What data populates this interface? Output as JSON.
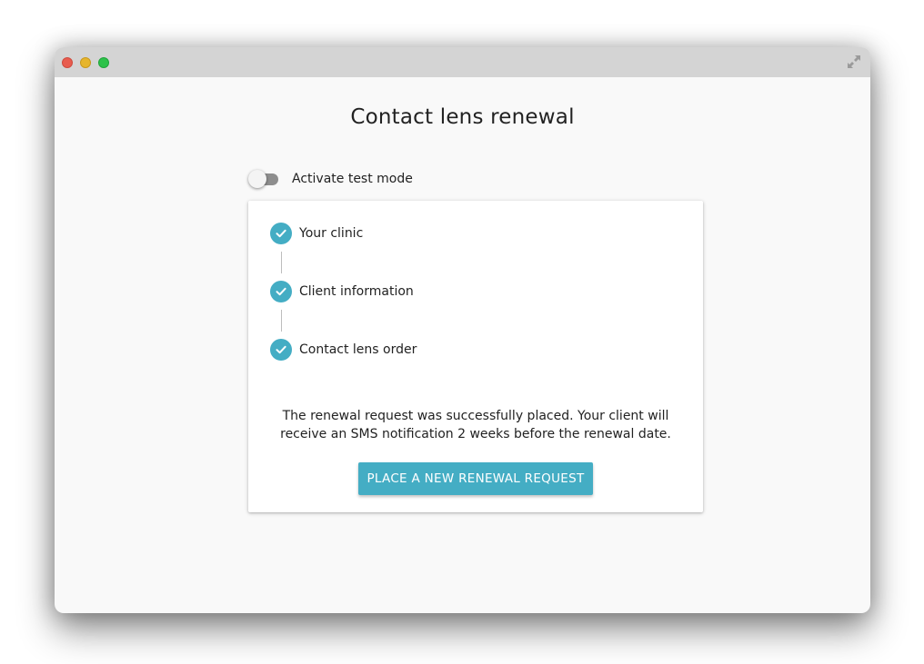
{
  "page": {
    "title": "Contact lens renewal"
  },
  "test_mode": {
    "label": "Activate test mode",
    "enabled": false
  },
  "steps": [
    {
      "label": "Your clinic",
      "completed": true,
      "icon": "check-icon"
    },
    {
      "label": "Client information",
      "completed": true,
      "icon": "check-icon"
    },
    {
      "label": "Contact lens order",
      "completed": true,
      "icon": "check-icon"
    }
  ],
  "confirmation": {
    "message": "The renewal request was successfully placed. Your client will receive an SMS notification 2 weeks before the renewal date."
  },
  "actions": {
    "new_request_label": "PLACE A NEW RENEWAL REQUEST"
  },
  "colors": {
    "accent": "#44adc4",
    "toggle_track_off": "#8e8e8e",
    "background": "#f9f9f9"
  }
}
